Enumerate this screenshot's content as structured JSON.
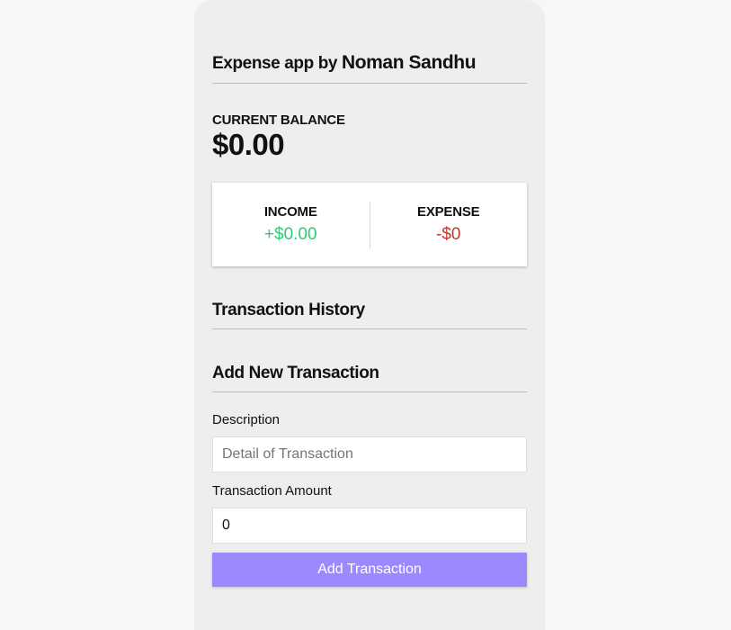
{
  "header": {
    "title_prefix": "Expense app by",
    "title_author": "Noman Sandhu"
  },
  "balance": {
    "label": "CURRENT BALANCE",
    "value": "$0.00"
  },
  "summary": {
    "income_label": "INCOME",
    "income_value": "+$0.00",
    "expense_label": "EXPENSE",
    "expense_value": "-$0"
  },
  "history": {
    "title": "Transaction History"
  },
  "form": {
    "title": "Add New Transaction",
    "description_label": "Description",
    "description_placeholder": "Detail of Transaction",
    "description_value": "",
    "amount_label": "Transaction Amount",
    "amount_value": "0",
    "submit_label": "Add Transaction"
  },
  "colors": {
    "income": "#2ecc71",
    "expense": "#c0392b",
    "button": "#9c88ff"
  }
}
